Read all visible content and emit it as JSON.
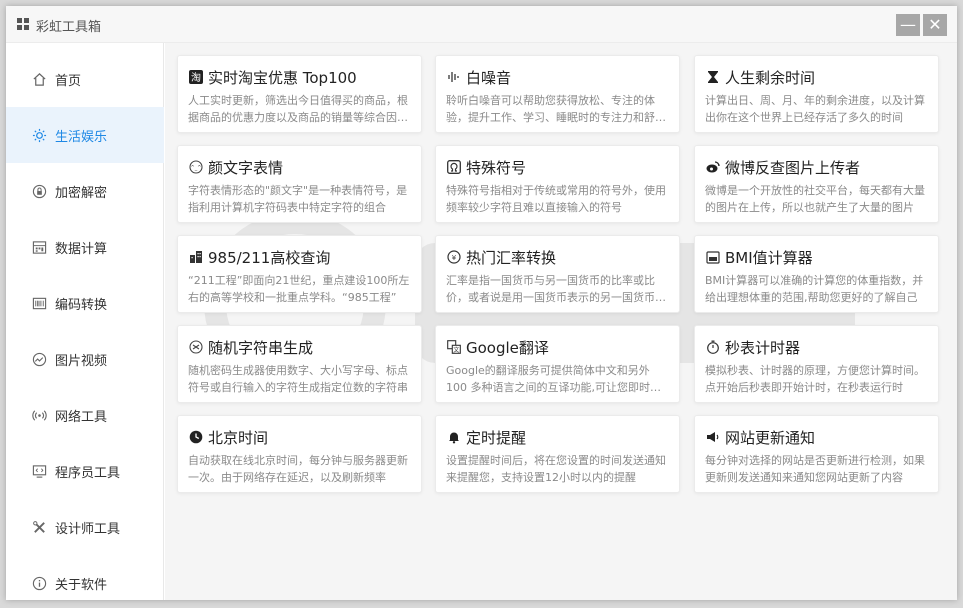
{
  "window": {
    "title": "彩虹工具箱",
    "minimize_label": "—",
    "close_label": "✕"
  },
  "colors": {
    "accent": "#1e88e5",
    "active_bg": "#eaf3fc"
  },
  "sidebar": {
    "items": [
      {
        "label": "首页",
        "icon": "home-icon"
      },
      {
        "label": "生活娱乐",
        "icon": "sun-icon",
        "active": true
      },
      {
        "label": "加密解密",
        "icon": "lock-icon"
      },
      {
        "label": "数据计算",
        "icon": "calculator-icon"
      },
      {
        "label": "编码转换",
        "icon": "barcode-icon"
      },
      {
        "label": "图片视频",
        "icon": "chart-circle-icon"
      },
      {
        "label": "网络工具",
        "icon": "wifi-icon"
      },
      {
        "label": "程序员工具",
        "icon": "monitor-code-icon"
      },
      {
        "label": "设计师工具",
        "icon": "design-tools-icon"
      },
      {
        "label": "关于软件",
        "icon": "info-icon"
      }
    ]
  },
  "cards": [
    {
      "title": "实时淘宝优惠 Top100",
      "icon": "taobao-icon",
      "desc": "人工实时更新，筛选出今日值得买的商品，根据商品的优惠力度以及商品的销量等综合因素推荐"
    },
    {
      "title": "白噪音",
      "icon": "sound-wave-icon",
      "desc": "聆听白噪音可以帮助您获得放松、专注的体验，提升工作、学习、睡眠时的专注力和舒适感"
    },
    {
      "title": "人生剩余时间",
      "icon": "hourglass-icon",
      "desc": "计算出日、周、月、年的剩余进度，以及计算出你在这个世界上已经存活了多久的时间"
    },
    {
      "title": "颜文字表情",
      "icon": "kaomoji-icon",
      "desc": "字符表情形态的\"颜文字\"是一种表情符号，是指利用计算机字符码表中特定字符的组合"
    },
    {
      "title": "特殊符号",
      "icon": "omega-icon",
      "desc": "特殊符号指相对于传统或常用的符号外，使用频率较少字符且难以直接输入的符号"
    },
    {
      "title": "微博反查图片上传者",
      "icon": "weibo-icon",
      "desc": "微博是一个开放性的社交平台，每天都有大量的图片在上传，所以也就产生了大量的图片"
    },
    {
      "title": "985/211高校查询",
      "icon": "building-icon",
      "desc": "“211工程”即面向21世纪，重点建设100所左右的高等学校和一批重点学科。“985工程”"
    },
    {
      "title": "热门汇率转换",
      "icon": "exchange-icon",
      "desc": "汇率是指一国货币与另一国货币的比率或比价，或者说是用一国货币表示的另一国货币的价格"
    },
    {
      "title": "BMI值计算器",
      "icon": "scale-icon",
      "desc": "BMI计算器可以准确的计算您的体重指数，并给出理想体重的范围,帮助您更好的了解自己"
    },
    {
      "title": "随机字符串生成",
      "icon": "random-icon",
      "desc": "随机密码生成器使用数字、大小写字母、标点符号或自行输入的字符生成指定位数的字符串"
    },
    {
      "title": "Google翻译",
      "icon": "translate-icon",
      "desc": "Google的翻译服务可提供简体中文和另外100 多种语言之间的互译功能,可让您即时翻译"
    },
    {
      "title": "秒表计时器",
      "icon": "stopwatch-icon",
      "desc": "模拟秒表、计时器的原理，方便您计算时间。点开始后秒表即开始计时，在秒表运行时"
    },
    {
      "title": "北京时间",
      "icon": "clock-icon",
      "desc": "自动获取在线北京时间，每分钟与服务器更新一次。由于网络存在延迟，以及刷新频率"
    },
    {
      "title": "定时提醒",
      "icon": "bell-icon",
      "desc": "设置提醒时间后，将在您设置的时间发送通知来提醒您，支持设置12小时以内的提醒"
    },
    {
      "title": "网站更新通知",
      "icon": "megaphone-icon",
      "desc": "每分钟对选择的网站是否更新进行检测，如果更新则发送通知来通知您网站更新了内容"
    }
  ]
}
